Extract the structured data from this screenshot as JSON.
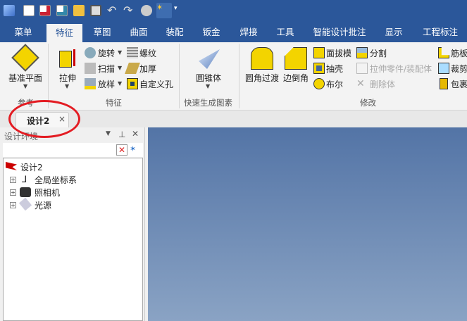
{
  "quick_access": [
    "app-logo-icon",
    "new-icon",
    "import-icon",
    "export-icon",
    "open-icon",
    "save-icon",
    "undo-icon",
    "redo-icon",
    "ball-icon",
    "design-tree-icon",
    "customize-icon"
  ],
  "tabs": [
    "菜单",
    "特征",
    "草图",
    "曲面",
    "装配",
    "钣金",
    "焊接",
    "工具",
    "智能设计批注",
    "显示",
    "工程标注"
  ],
  "active_tab": "特征",
  "ribbon": {
    "ref": {
      "plane": "基准平面",
      "group": "参考"
    },
    "feature": {
      "extrude": "拉伸",
      "revolve": "旋转",
      "sweep": "扫描",
      "loft": "放样",
      "thread": "螺纹",
      "thicken": "加厚",
      "custom_hole": "自定义孔",
      "group": "特征"
    },
    "quick": {
      "cone": "圆锥体",
      "group": "快速生成图素"
    },
    "modify": {
      "fillet": "圆角过渡",
      "chamfer": "边倒角",
      "draft": "面拔模",
      "shell": "抽壳",
      "boolean": "布尔",
      "split": "分割",
      "stretch_part": "拉伸零件/装配体",
      "delete_body": "删除体",
      "rib": "筋板",
      "cut": "裁剪",
      "wrap": "包裹",
      "group": "修改"
    }
  },
  "doc_tab": {
    "label": "设计2",
    "close": "×"
  },
  "panel": {
    "title": "设计环境",
    "tree": {
      "root": "设计2",
      "items": [
        "全局坐标系",
        "照相机",
        "光源"
      ]
    }
  },
  "colors": {
    "accent": "#2b579a",
    "annotation": "#e31c23"
  }
}
